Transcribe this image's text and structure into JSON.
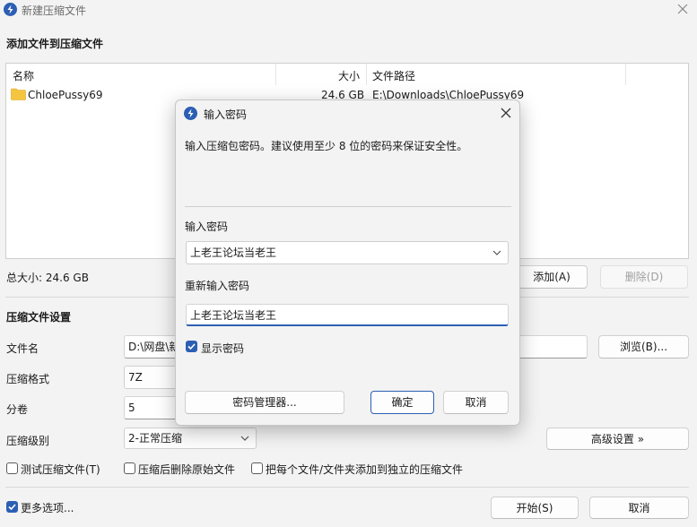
{
  "window": {
    "title": "新建压缩文件",
    "add_files_heading": "添加文件到压缩文件"
  },
  "file_list": {
    "columns": {
      "name": "名称",
      "size": "大小",
      "path": "文件路径"
    },
    "rows": [
      {
        "name": "ChloePussy69",
        "size": "24.6 GB",
        "path": "E:\\Downloads\\ChloePussy69"
      }
    ],
    "total": "总大小: 24.6 GB",
    "add_button": "添加(A)",
    "delete_button": "删除(D)"
  },
  "settings": {
    "heading": "压缩文件设置",
    "filename_label": "文件名",
    "filename_value": "D:\\网盘\\新",
    "browse_button": "浏览(B)...",
    "format_label": "压缩格式",
    "format_value": "7Z",
    "split_label": "分卷",
    "split_value": "5",
    "level_label": "压缩级别",
    "level_value": "2-正常压缩",
    "advanced_button": "高级设置 »",
    "test_label": "测试压缩文件(T)",
    "delete_after_label": "压缩后删除原始文件",
    "separate_label": "把每个文件/文件夹添加到独立的压缩文件",
    "more_options_label": "更多选项...",
    "start_button": "开始(S)",
    "cancel_button": "取消"
  },
  "dialog": {
    "title": "输入密码",
    "description": "输入压缩包密码。建议使用至少 8 位的密码来保证安全性。",
    "password_label": "输入密码",
    "password_value": "上老王论坛当老王",
    "confirm_label": "重新输入密码",
    "confirm_value": "上老王论坛当老王",
    "show_password_label": "显示密码",
    "manager_button": "密码管理器...",
    "ok_button": "确定",
    "cancel_button": "取消"
  },
  "colors": {
    "accent": "#2c5fb3",
    "folder": "#f5c542"
  }
}
